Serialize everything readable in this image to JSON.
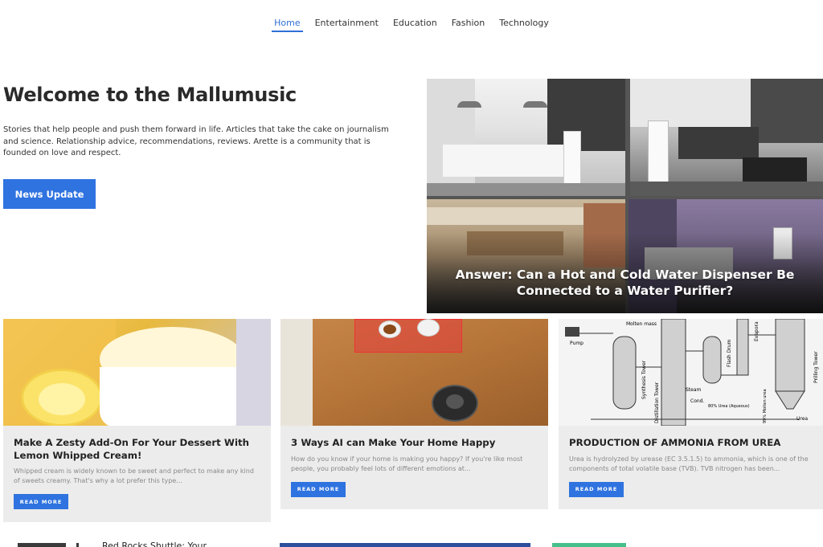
{
  "nav": {
    "items": [
      {
        "label": "Home",
        "active": true
      },
      {
        "label": "Entertainment",
        "active": false
      },
      {
        "label": "Education",
        "active": false
      },
      {
        "label": "Fashion",
        "active": false
      },
      {
        "label": "Technology",
        "active": false
      }
    ]
  },
  "hero": {
    "title": "Welcome to the Mallumusic",
    "description": "Stories that help people and push them forward in life. Articles that take the cake on journalism and science. Relationship advice, recommendations, reviews. Arette is a community that is founded on love and respect.",
    "button_label": "News Update",
    "featured_caption": "Answer: Can a Hot and Cold Water Dispenser Be Connected to a Water Purifier?"
  },
  "cards": [
    {
      "title": "Make A Zesty Add-On For Your Dessert With Lemon Whipped Cream!",
      "excerpt": "Whipped cream is widely known to be sweet and perfect to make any kind of sweets creamy. That's why a lot prefer this type...",
      "button_label": "READ MORE"
    },
    {
      "title": "3 Ways AI can Make Your Home Happy",
      "excerpt": "How do you know if your home is making you happy? If you're like most people, you probably feel lots of different emotions at...",
      "button_label": "READ MORE"
    },
    {
      "title": "PRODUCTION OF AMMONIA FROM UREA",
      "excerpt": "Urea is hydrolyzed by urease (EC 3.5.1.5) to ammonia, which is one of the components of total volatile base (TVB). TVB nitrogen has been...",
      "button_label": "READ MORE"
    }
  ],
  "diagram_labels": {
    "molten_mass": "Molten mass",
    "pump": "Pump",
    "synthesis_tower": "Synthesis Tower",
    "distillation_tower": "Distillation Tower",
    "steam": "Steam",
    "flash_drum": "Flash Drum",
    "evaporator": "Evapora",
    "prilling_tower": "Prilling Tower",
    "cond": "Cond.",
    "urea_aqueous": "80% Urea (Aqueous)",
    "molten_urea": "99% Molten urea",
    "urea": "Urea"
  },
  "bottom": {
    "post_title": "Red Rocks Shuttle: Your"
  },
  "colors": {
    "accent": "#2f73e0",
    "card_bg": "#ececec"
  }
}
